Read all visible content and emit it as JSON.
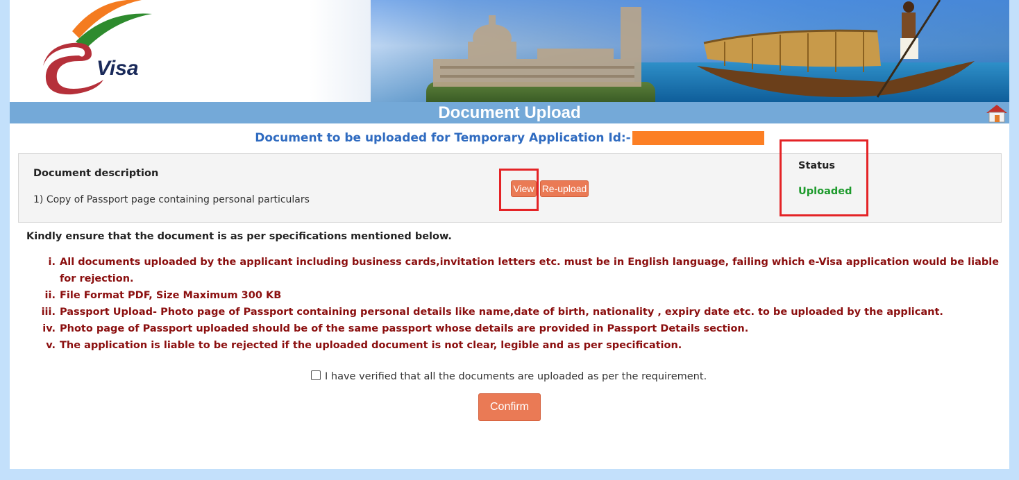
{
  "header": {
    "logo_text": "Visa",
    "title": "Document Upload"
  },
  "subheading": "Document to be uploaded for Temporary Application Id:-",
  "document": {
    "description_heading": "Document description",
    "item": "1) Copy of Passport page containing personal particulars",
    "view_label": "View",
    "reupload_label": "Re-upload",
    "status_heading": "Status",
    "status_value": "Uploaded"
  },
  "specs": {
    "intro": "Kindly ensure that the document is as per specifications mentioned below.",
    "items": [
      {
        "num": "i.",
        "text": "All documents uploaded by the applicant including business cards,invitation letters etc. must be in English language, failing which e-Visa application would be liable for rejection."
      },
      {
        "num": "ii.",
        "text": "File Format PDF, Size Maximum 300 KB"
      },
      {
        "num": "iii.",
        "text": "Passport Upload- Photo page of Passport containing personal details like name,date of birth, nationality , expiry date etc. to be uploaded by the applicant."
      },
      {
        "num": "iv.",
        "text": "Photo page of Passport uploaded should be of the same passport whose details are provided in Passport Details section."
      },
      {
        "num": "v.",
        "text": "The application is liable to be rejected if the uploaded document is not clear, legible and as per specification."
      }
    ]
  },
  "verification": {
    "checkbox_label": "I have verified that all the documents are uploaded as per the requirement.",
    "checked": false
  },
  "confirm_label": "Confirm",
  "colors": {
    "page_bg": "#c3e0fb",
    "title_bar": "#74a9d8",
    "button": "#ea7a55",
    "spec_text": "#8b0f0f",
    "status_ok": "#1c9a2b",
    "highlight": "#e42326",
    "redaction": "#fc7f24"
  }
}
